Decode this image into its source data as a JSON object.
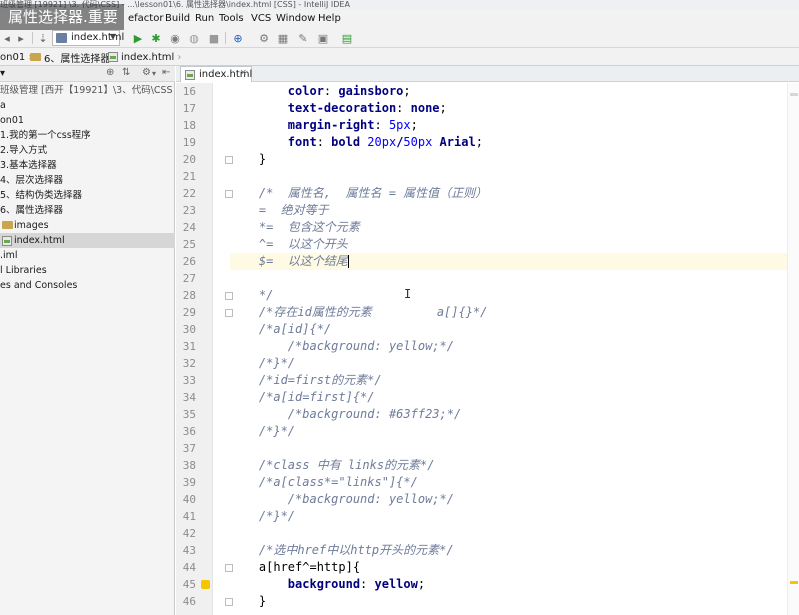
{
  "window": {
    "title": "班级管理 [19921] \\3. 代码\\CSS] - ...\\lesson01\\6. 属性选择器\\index.html [CSS] - IntelliJ IDEA",
    "video_caption": "属性选择器.重要"
  },
  "menu": [
    "efactor",
    "Build",
    "Run",
    "Tools",
    "VCS",
    "Window",
    "Help"
  ],
  "toolbar": {
    "run_config": "index.html"
  },
  "breadcrumb": [
    "on01",
    "6、属性选择器",
    "index.html"
  ],
  "project": {
    "root": "班级管理 [西开【19921】\\3、代码\\CSS",
    "items": [
      {
        "label": "a",
        "type": "folder",
        "indent": 0
      },
      {
        "label": "on01",
        "type": "folder",
        "indent": 0
      },
      {
        "label": "1.我的第一个css程序",
        "type": "folder",
        "indent": 1
      },
      {
        "label": "2.导入方式",
        "type": "folder",
        "indent": 1
      },
      {
        "label": "3.基本选择器",
        "type": "folder",
        "indent": 1
      },
      {
        "label": "4、层次选择器",
        "type": "folder",
        "indent": 1
      },
      {
        "label": "5、结构伪类选择器",
        "type": "folder",
        "indent": 1
      },
      {
        "label": "6、属性选择器",
        "type": "folder",
        "indent": 1
      },
      {
        "label": "images",
        "type": "folder",
        "indent": 2
      },
      {
        "label": "index.html",
        "type": "file",
        "indent": 2,
        "selected": true
      },
      {
        "label": ".iml",
        "type": "file",
        "indent": 0
      },
      {
        "label": "l Libraries",
        "type": "lib",
        "indent": 0
      },
      {
        "label": "es and Consoles",
        "type": "lib",
        "indent": 0
      }
    ]
  },
  "editor": {
    "tab": "index.html",
    "current_line": 26,
    "lines": [
      {
        "n": "16",
        "segs": [
          {
            "c": "prop",
            "t": "        color"
          },
          {
            "c": "punc",
            "t": ": "
          },
          {
            "c": "val",
            "t": "gainsboro"
          },
          {
            "c": "punc",
            "t": ";"
          }
        ]
      },
      {
        "n": "17",
        "segs": [
          {
            "c": "prop",
            "t": "        text-decoration"
          },
          {
            "c": "punc",
            "t": ": "
          },
          {
            "c": "val",
            "t": "none"
          },
          {
            "c": "punc",
            "t": ";"
          }
        ]
      },
      {
        "n": "18",
        "segs": [
          {
            "c": "prop",
            "t": "        margin-right"
          },
          {
            "c": "punc",
            "t": ": "
          },
          {
            "c": "num",
            "t": "5px"
          },
          {
            "c": "punc",
            "t": ";"
          }
        ]
      },
      {
        "n": "19",
        "segs": [
          {
            "c": "prop",
            "t": "        font"
          },
          {
            "c": "punc",
            "t": ": "
          },
          {
            "c": "val",
            "t": "bold "
          },
          {
            "c": "num",
            "t": "20px"
          },
          {
            "c": "val",
            "t": "/"
          },
          {
            "c": "num",
            "t": "50px"
          },
          {
            "c": "val",
            "t": " Arial"
          },
          {
            "c": "punc",
            "t": ";"
          }
        ]
      },
      {
        "n": "20",
        "segs": [
          {
            "c": "punc",
            "t": "    }"
          }
        ]
      },
      {
        "n": "21",
        "segs": []
      },
      {
        "n": "22",
        "segs": [
          {
            "c": "com",
            "t": "    /*  属性名,  属性名 = 属性值（正则）"
          }
        ]
      },
      {
        "n": "23",
        "segs": [
          {
            "c": "com",
            "t": "    =  绝对等于"
          }
        ]
      },
      {
        "n": "24",
        "segs": [
          {
            "c": "com",
            "t": "    *=  包含这个元素"
          }
        ]
      },
      {
        "n": "25",
        "segs": [
          {
            "c": "com",
            "t": "    ^=  以这个开头"
          }
        ]
      },
      {
        "n": "26",
        "segs": [
          {
            "c": "com",
            "t": "    $=  以这个结尾"
          }
        ],
        "caret": true
      },
      {
        "n": "27",
        "segs": []
      },
      {
        "n": "28",
        "segs": [
          {
            "c": "com",
            "t": "    */"
          }
        ]
      },
      {
        "n": "29",
        "segs": [
          {
            "c": "com",
            "t": "    /*存在id属性的元素         a[]{}*/"
          }
        ]
      },
      {
        "n": "30",
        "segs": [
          {
            "c": "com",
            "t": "    /*a[id]{*/"
          }
        ]
      },
      {
        "n": "31",
        "segs": [
          {
            "c": "com",
            "t": "        /*background: yellow;*/"
          }
        ]
      },
      {
        "n": "32",
        "segs": [
          {
            "c": "com",
            "t": "    /*}*/"
          }
        ]
      },
      {
        "n": "33",
        "segs": [
          {
            "c": "com",
            "t": "    /*id=first的元素*/"
          }
        ]
      },
      {
        "n": "34",
        "segs": [
          {
            "c": "com",
            "t": "    /*a[id=first]{*/"
          }
        ]
      },
      {
        "n": "35",
        "segs": [
          {
            "c": "com",
            "t": "        /*background: #63ff23;*/"
          }
        ]
      },
      {
        "n": "36",
        "segs": [
          {
            "c": "com",
            "t": "    /*}*/"
          }
        ]
      },
      {
        "n": "37",
        "segs": []
      },
      {
        "n": "38",
        "segs": [
          {
            "c": "com",
            "t": "    /*class 中有 links的元素*/"
          }
        ]
      },
      {
        "n": "39",
        "segs": [
          {
            "c": "com",
            "t": "    /*a[class*=\"links\"]{*/"
          }
        ]
      },
      {
        "n": "40",
        "segs": [
          {
            "c": "com",
            "t": "        /*background: yellow;*/"
          }
        ]
      },
      {
        "n": "41",
        "segs": [
          {
            "c": "com",
            "t": "    /*}*/"
          }
        ]
      },
      {
        "n": "42",
        "segs": []
      },
      {
        "n": "43",
        "segs": [
          {
            "c": "com",
            "t": "    /*选中href中以http开头的元素*/"
          }
        ]
      },
      {
        "n": "44",
        "segs": [
          {
            "c": "sel",
            "t": "    a[href^=http]{"
          }
        ]
      },
      {
        "n": "45",
        "segs": [
          {
            "c": "prop",
            "t": "        background"
          },
          {
            "c": "punc",
            "t": ": "
          },
          {
            "c": "val",
            "t": "yellow"
          },
          {
            "c": "punc",
            "t": ";"
          }
        ]
      },
      {
        "n": "46",
        "segs": [
          {
            "c": "punc",
            "t": "    }"
          }
        ]
      }
    ]
  }
}
